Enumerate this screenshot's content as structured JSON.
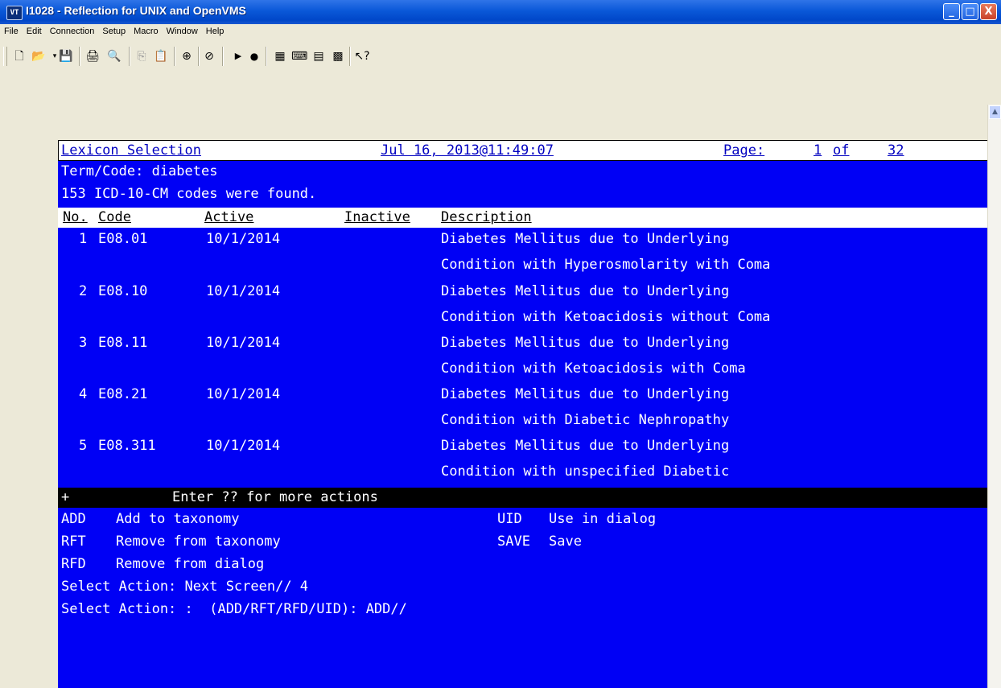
{
  "window": {
    "title": "I1028 - Reflection for UNIX and OpenVMS",
    "icon_label": "VT",
    "buttons": {
      "minimize": "_",
      "maximize": "□",
      "close": "X"
    }
  },
  "menu": [
    "File",
    "Edit",
    "Connection",
    "Setup",
    "Macro",
    "Window",
    "Help"
  ],
  "toolbar_icons": [
    "new-icon",
    "open-icon",
    "save-icon",
    "print-icon",
    "find-icon",
    "copy-icon",
    "paste-icon",
    "connect-icon",
    "disconnect-icon",
    "play-icon",
    "record-icon",
    "display-setup-icon",
    "keyboard-icon",
    "terminal-setup-icon",
    "toolbar-setup-icon",
    "help-icon"
  ],
  "terminal": {
    "header": {
      "title": "Lexicon Selection",
      "datetime": "Jul 16, 2013@11:49:07",
      "page_label": "Page:",
      "page_current": "1",
      "page_of": "of",
      "page_total": "32"
    },
    "term_line": "Term/Code: diabetes",
    "found_line": "153 ICD-10-CM codes were found.",
    "columns": {
      "no": "No.",
      "code": "Code",
      "active": "Active",
      "inactive": "Inactive",
      "description": "Description"
    },
    "rows": [
      {
        "no": "1",
        "code": "E08.01",
        "active": "10/1/2014",
        "inactive": "",
        "desc1": "Diabetes Mellitus due to Underlying",
        "desc2": "Condition with Hyperosmolarity with Coma"
      },
      {
        "no": "2",
        "code": "E08.10",
        "active": "10/1/2014",
        "inactive": "",
        "desc1": "Diabetes Mellitus due to Underlying",
        "desc2": "Condition with Ketoacidosis without Coma"
      },
      {
        "no": "3",
        "code": "E08.11",
        "active": "10/1/2014",
        "inactive": "",
        "desc1": "Diabetes Mellitus due to Underlying",
        "desc2": "Condition with Ketoacidosis with Coma"
      },
      {
        "no": "4",
        "code": "E08.21",
        "active": "10/1/2014",
        "inactive": "",
        "desc1": "Diabetes Mellitus due to Underlying",
        "desc2": "Condition with Diabetic Nephropathy"
      },
      {
        "no": "5",
        "code": "E08.311",
        "active": "10/1/2014",
        "inactive": "",
        "desc1": "Diabetes Mellitus due to Underlying",
        "desc2": "Condition with unspecified Diabetic"
      }
    ],
    "more_marker": "+",
    "more_text": "Enter ?? for more actions",
    "actions": [
      {
        "code": "ADD",
        "label": "Add to taxonomy"
      },
      {
        "code": "RFT",
        "label": "Remove from taxonomy"
      },
      {
        "code": "RFD",
        "label": "Remove from dialog"
      },
      {
        "code": "UID",
        "label": "Use in dialog"
      },
      {
        "code": "SAVE",
        "label": "Save"
      }
    ],
    "prompt1": "Select Action: Next Screen// 4",
    "prompt2": "Select Action: :  (ADD/RFT/RFD/UID): ADD//"
  }
}
